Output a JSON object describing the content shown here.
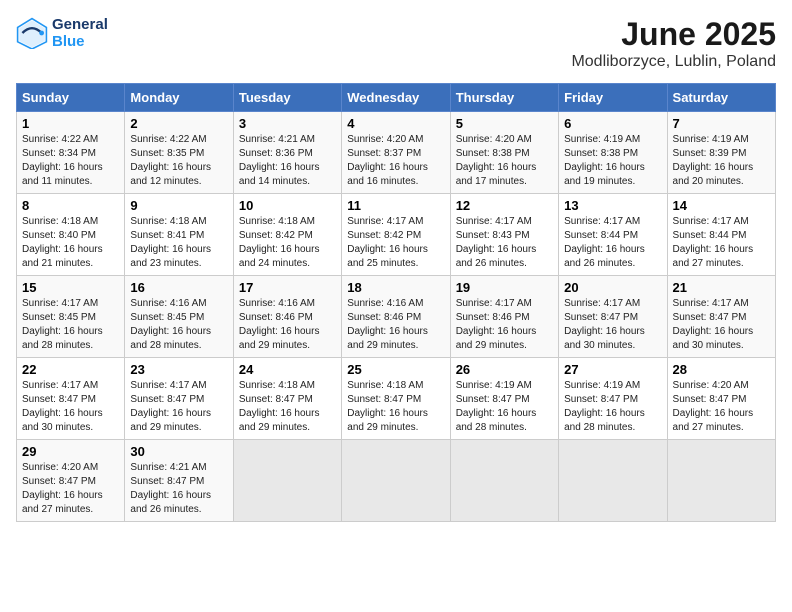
{
  "header": {
    "logo_line1": "General",
    "logo_line2": "Blue",
    "title": "June 2025",
    "subtitle": "Modliborzyce, Lublin, Poland"
  },
  "columns": [
    "Sunday",
    "Monday",
    "Tuesday",
    "Wednesday",
    "Thursday",
    "Friday",
    "Saturday"
  ],
  "weeks": [
    [
      {
        "day": "1",
        "info": "Sunrise: 4:22 AM\nSunset: 8:34 PM\nDaylight: 16 hours\nand 11 minutes."
      },
      {
        "day": "2",
        "info": "Sunrise: 4:22 AM\nSunset: 8:35 PM\nDaylight: 16 hours\nand 12 minutes."
      },
      {
        "day": "3",
        "info": "Sunrise: 4:21 AM\nSunset: 8:36 PM\nDaylight: 16 hours\nand 14 minutes."
      },
      {
        "day": "4",
        "info": "Sunrise: 4:20 AM\nSunset: 8:37 PM\nDaylight: 16 hours\nand 16 minutes."
      },
      {
        "day": "5",
        "info": "Sunrise: 4:20 AM\nSunset: 8:38 PM\nDaylight: 16 hours\nand 17 minutes."
      },
      {
        "day": "6",
        "info": "Sunrise: 4:19 AM\nSunset: 8:38 PM\nDaylight: 16 hours\nand 19 minutes."
      },
      {
        "day": "7",
        "info": "Sunrise: 4:19 AM\nSunset: 8:39 PM\nDaylight: 16 hours\nand 20 minutes."
      }
    ],
    [
      {
        "day": "8",
        "info": "Sunrise: 4:18 AM\nSunset: 8:40 PM\nDaylight: 16 hours\nand 21 minutes."
      },
      {
        "day": "9",
        "info": "Sunrise: 4:18 AM\nSunset: 8:41 PM\nDaylight: 16 hours\nand 23 minutes."
      },
      {
        "day": "10",
        "info": "Sunrise: 4:18 AM\nSunset: 8:42 PM\nDaylight: 16 hours\nand 24 minutes."
      },
      {
        "day": "11",
        "info": "Sunrise: 4:17 AM\nSunset: 8:42 PM\nDaylight: 16 hours\nand 25 minutes."
      },
      {
        "day": "12",
        "info": "Sunrise: 4:17 AM\nSunset: 8:43 PM\nDaylight: 16 hours\nand 26 minutes."
      },
      {
        "day": "13",
        "info": "Sunrise: 4:17 AM\nSunset: 8:44 PM\nDaylight: 16 hours\nand 26 minutes."
      },
      {
        "day": "14",
        "info": "Sunrise: 4:17 AM\nSunset: 8:44 PM\nDaylight: 16 hours\nand 27 minutes."
      }
    ],
    [
      {
        "day": "15",
        "info": "Sunrise: 4:17 AM\nSunset: 8:45 PM\nDaylight: 16 hours\nand 28 minutes."
      },
      {
        "day": "16",
        "info": "Sunrise: 4:16 AM\nSunset: 8:45 PM\nDaylight: 16 hours\nand 28 minutes."
      },
      {
        "day": "17",
        "info": "Sunrise: 4:16 AM\nSunset: 8:46 PM\nDaylight: 16 hours\nand 29 minutes."
      },
      {
        "day": "18",
        "info": "Sunrise: 4:16 AM\nSunset: 8:46 PM\nDaylight: 16 hours\nand 29 minutes."
      },
      {
        "day": "19",
        "info": "Sunrise: 4:17 AM\nSunset: 8:46 PM\nDaylight: 16 hours\nand 29 minutes."
      },
      {
        "day": "20",
        "info": "Sunrise: 4:17 AM\nSunset: 8:47 PM\nDaylight: 16 hours\nand 30 minutes."
      },
      {
        "day": "21",
        "info": "Sunrise: 4:17 AM\nSunset: 8:47 PM\nDaylight: 16 hours\nand 30 minutes."
      }
    ],
    [
      {
        "day": "22",
        "info": "Sunrise: 4:17 AM\nSunset: 8:47 PM\nDaylight: 16 hours\nand 30 minutes."
      },
      {
        "day": "23",
        "info": "Sunrise: 4:17 AM\nSunset: 8:47 PM\nDaylight: 16 hours\nand 29 minutes."
      },
      {
        "day": "24",
        "info": "Sunrise: 4:18 AM\nSunset: 8:47 PM\nDaylight: 16 hours\nand 29 minutes."
      },
      {
        "day": "25",
        "info": "Sunrise: 4:18 AM\nSunset: 8:47 PM\nDaylight: 16 hours\nand 29 minutes."
      },
      {
        "day": "26",
        "info": "Sunrise: 4:19 AM\nSunset: 8:47 PM\nDaylight: 16 hours\nand 28 minutes."
      },
      {
        "day": "27",
        "info": "Sunrise: 4:19 AM\nSunset: 8:47 PM\nDaylight: 16 hours\nand 28 minutes."
      },
      {
        "day": "28",
        "info": "Sunrise: 4:20 AM\nSunset: 8:47 PM\nDaylight: 16 hours\nand 27 minutes."
      }
    ],
    [
      {
        "day": "29",
        "info": "Sunrise: 4:20 AM\nSunset: 8:47 PM\nDaylight: 16 hours\nand 27 minutes."
      },
      {
        "day": "30",
        "info": "Sunrise: 4:21 AM\nSunset: 8:47 PM\nDaylight: 16 hours\nand 26 minutes."
      },
      {
        "day": "",
        "info": ""
      },
      {
        "day": "",
        "info": ""
      },
      {
        "day": "",
        "info": ""
      },
      {
        "day": "",
        "info": ""
      },
      {
        "day": "",
        "info": ""
      }
    ]
  ]
}
